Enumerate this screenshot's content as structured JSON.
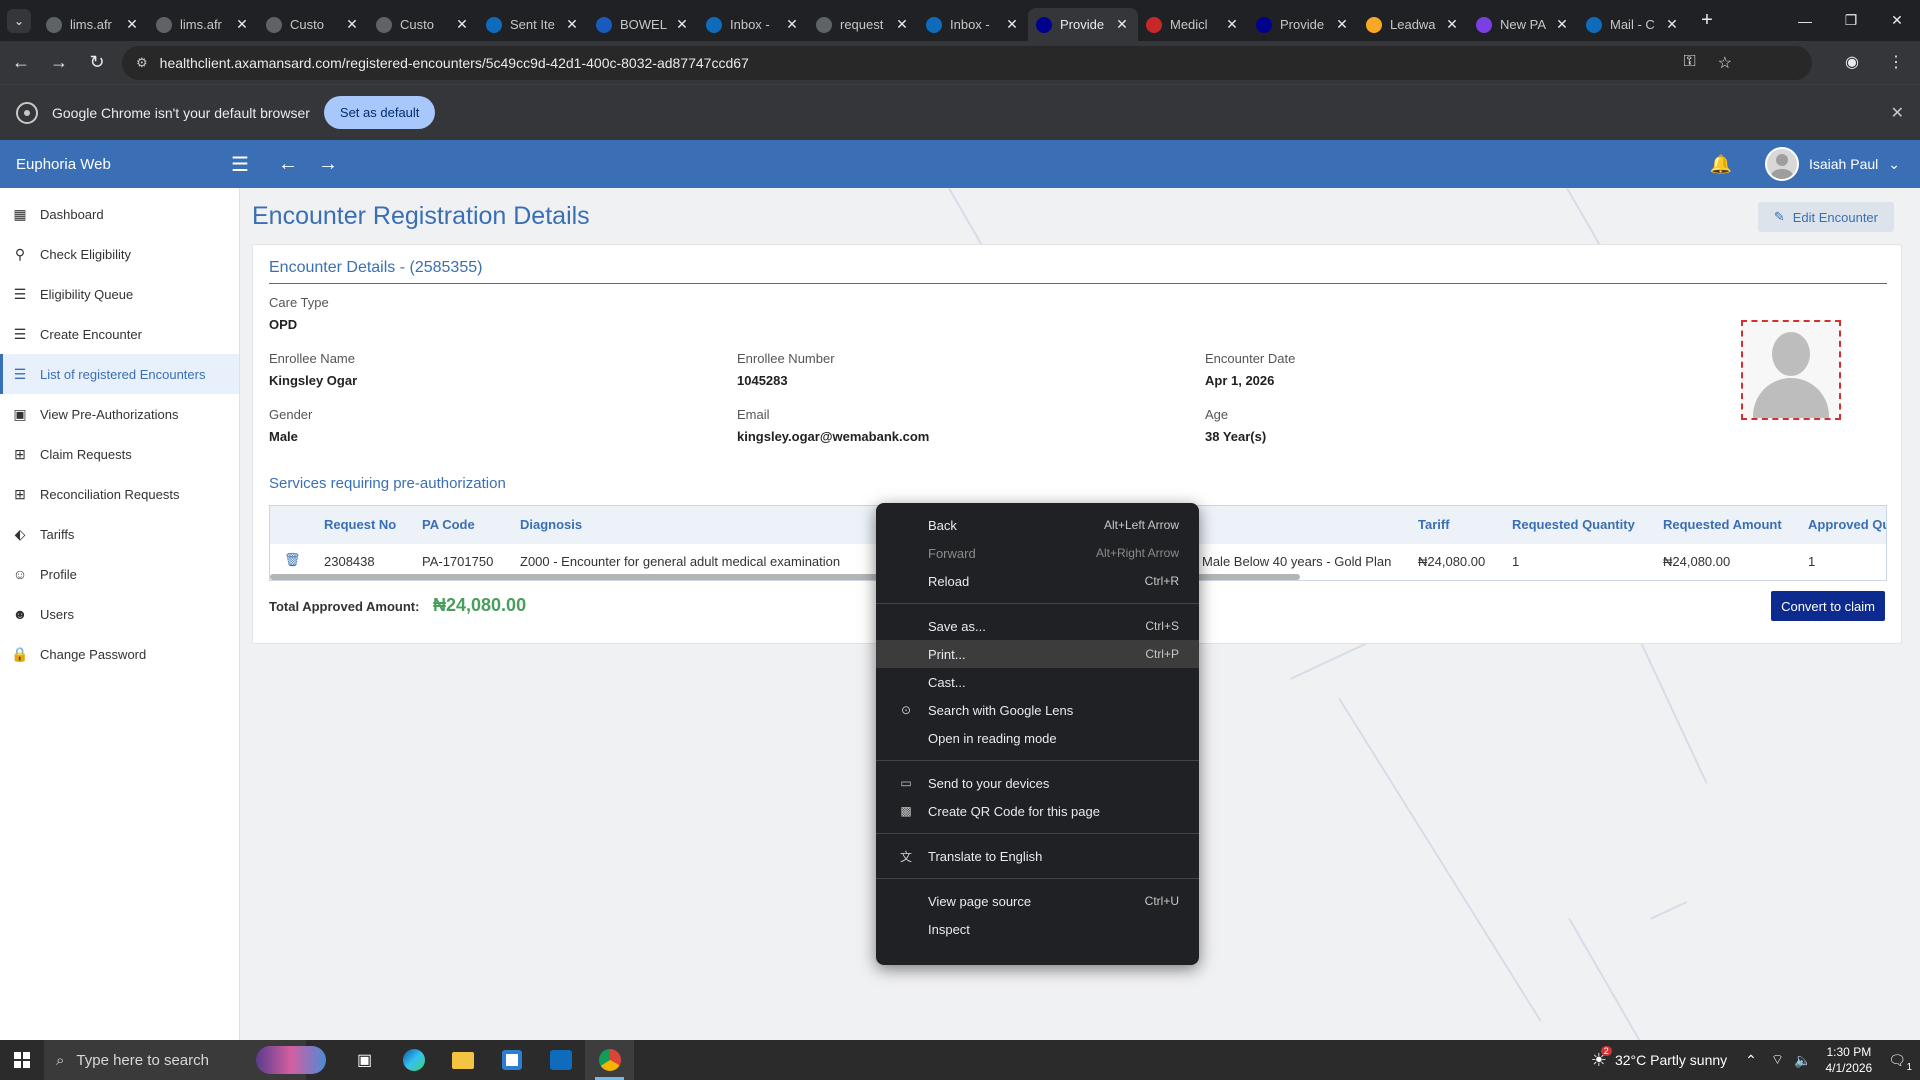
{
  "browser": {
    "tabs": [
      {
        "title": "lims.afr",
        "favicon_color": "#5f6368",
        "icon": "globe-icon"
      },
      {
        "title": "lims.afr",
        "favicon_color": "#5f6368",
        "icon": "globe-icon"
      },
      {
        "title": "Custo",
        "favicon_color": "#5f6368",
        "icon": "globe-icon"
      },
      {
        "title": "Custo",
        "favicon_color": "#5f6368",
        "icon": "globe-icon"
      },
      {
        "title": "Sent Ite",
        "favicon_color": "#0f6cbd",
        "icon": "outlook-icon"
      },
      {
        "title": "BOWEL",
        "favicon_color": "#185abd",
        "icon": "word-icon"
      },
      {
        "title": "Inbox -",
        "favicon_color": "#0f6cbd",
        "icon": "outlook-icon"
      },
      {
        "title": "request",
        "favicon_color": "#5f6368",
        "icon": "globe-icon"
      },
      {
        "title": "Inbox -",
        "favicon_color": "#0f6cbd",
        "icon": "outlook-icon"
      },
      {
        "title": "Provide",
        "favicon_color": "#00008f",
        "icon": "axa-icon",
        "active": true
      },
      {
        "title": "Medicl",
        "favicon_color": "#c62828",
        "icon": "medicloud-icon"
      },
      {
        "title": "Provide",
        "favicon_color": "#00008f",
        "icon": "axa-icon"
      },
      {
        "title": "Leadwa",
        "favicon_color": "#f9a825",
        "icon": "leadway-icon"
      },
      {
        "title": "New PA",
        "favicon_color": "#7b3fe4",
        "icon": "app-icon"
      },
      {
        "title": "Mail - C",
        "favicon_color": "#0f6cbd",
        "icon": "outlook-icon"
      }
    ],
    "url": "healthclient.axamansard.com/registered-encounters/5c49cc9d-42d1-400c-8032-ad87747ccd67",
    "infobar_message": "Google Chrome isn't your default browser",
    "infobar_button": "Set as default"
  },
  "app": {
    "brand": "Euphoria Web",
    "user_name": "Isaiah Paul",
    "accent_color": "#3a6fb5"
  },
  "sidebar": {
    "items": [
      {
        "label": "Dashboard",
        "icon": "dashboard-icon"
      },
      {
        "label": "Check Eligibility",
        "icon": "person-search-icon"
      },
      {
        "label": "Eligibility Queue",
        "icon": "list-icon"
      },
      {
        "label": "Create Encounter",
        "icon": "list-icon"
      },
      {
        "label": "List of registered Encounters",
        "icon": "list-icon",
        "active": true
      },
      {
        "label": "View Pre-Authorizations",
        "icon": "contacts-icon"
      },
      {
        "label": "Claim Requests",
        "icon": "grid-icon"
      },
      {
        "label": "Reconciliation Requests",
        "icon": "grid-icon"
      },
      {
        "label": "Tariffs",
        "icon": "tag-icon"
      },
      {
        "label": "Profile",
        "icon": "person-icon"
      },
      {
        "label": "Users",
        "icon": "users-icon"
      },
      {
        "label": "Change Password",
        "icon": "lock-icon"
      }
    ]
  },
  "page": {
    "title": "Encounter Registration Details",
    "edit_button": "Edit Encounter",
    "section_title": "Encounter Details - (2585355)",
    "care_type_label": "Care Type",
    "care_type": "OPD",
    "enrollee_name_label": "Enrollee Name",
    "enrollee_name": "Kingsley Ogar",
    "enrollee_number_label": "Enrollee Number",
    "enrollee_number": "1045283",
    "encounter_date_label": "Encounter Date",
    "encounter_date": "Apr 1, 2026",
    "gender_label": "Gender",
    "gender": "Male",
    "email_label": "Email",
    "email": "kingsley.ogar@wemabank.com",
    "age_label": "Age",
    "age": "38 Year(s)",
    "services_title": "Services requiring pre-authorization",
    "table": {
      "headers": [
        "Request No",
        "PA Code",
        "Diagnosis",
        "",
        "Tariff",
        "Requested Quantity",
        "Requested Amount",
        "Approved Qu"
      ],
      "row": {
        "request_no": "2308438",
        "pa_code": "PA-1701750",
        "diagnosis": "Z000 - Encounter for general adult medical examination",
        "plan": "Male Below 40 years - Gold Plan",
        "tariff": "₦24,080.00",
        "requested_quantity": "1",
        "requested_amount": "₦24,080.00",
        "approved_quantity": "1"
      }
    },
    "total_label": "Total Approved Amount:",
    "total_value": "₦24,080.00",
    "total_color": "#4a9d5b",
    "convert_button": "Convert to claim"
  },
  "context_menu": {
    "items": [
      {
        "label": "Back",
        "shortcut": "Alt+Left Arrow"
      },
      {
        "label": "Forward",
        "shortcut": "Alt+Right Arrow",
        "disabled": true
      },
      {
        "label": "Reload",
        "shortcut": "Ctrl+R"
      },
      {
        "label": "Save as...",
        "shortcut": "Ctrl+S"
      },
      {
        "label": "Print...",
        "shortcut": "Ctrl+P",
        "highlighted": true
      },
      {
        "label": "Cast..."
      },
      {
        "label": "Search with Google Lens",
        "icon": "lens-icon"
      },
      {
        "label": "Open in reading mode"
      },
      {
        "label": "Send to your devices",
        "icon": "devices-icon"
      },
      {
        "label": "Create QR Code for this page",
        "icon": "qr-code-icon"
      },
      {
        "label": "Translate to English",
        "icon": "translate-icon"
      },
      {
        "label": "View page source",
        "shortcut": "Ctrl+U"
      },
      {
        "label": "Inspect"
      }
    ]
  },
  "taskbar": {
    "search_placeholder": "Type here to search",
    "weather": "32°C  Partly sunny",
    "weather_badge": "2",
    "time": "1:30 PM",
    "date": "4/1/2026",
    "notification_count": "1"
  }
}
